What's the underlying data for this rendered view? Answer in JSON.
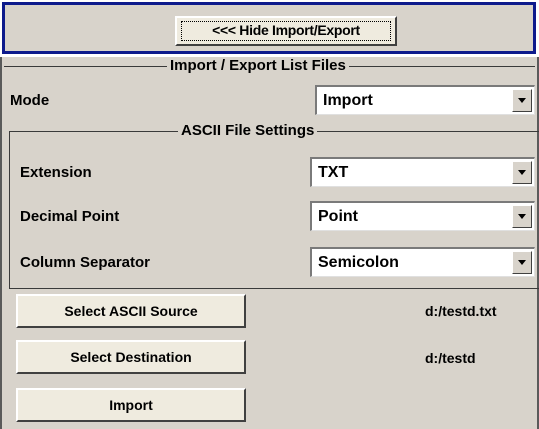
{
  "header": {
    "hide_button_label": "<<< Hide Import/Export"
  },
  "import_export": {
    "group_title": "Import / Export List Files",
    "mode": {
      "label": "Mode",
      "value": "Import"
    },
    "ascii_settings": {
      "group_title": "ASCII File Settings",
      "extension": {
        "label": "Extension",
        "value": "TXT"
      },
      "decimal_point": {
        "label": "Decimal Point",
        "value": "Point"
      },
      "column_separator": {
        "label": "Column Separator",
        "value": "Semicolon"
      }
    },
    "select_source": {
      "label": "Select ASCII Source",
      "value": "d:/testd.txt"
    },
    "select_destination": {
      "label": "Select Destination",
      "value": "d:/testd"
    },
    "action": {
      "label": "Import"
    }
  },
  "icons": {
    "dropdown": "chevron-down-icon"
  },
  "colors": {
    "frame_blue": "#0d1a8c",
    "panel_bg": "#d8d3cb",
    "button_bg": "#efebdf"
  }
}
